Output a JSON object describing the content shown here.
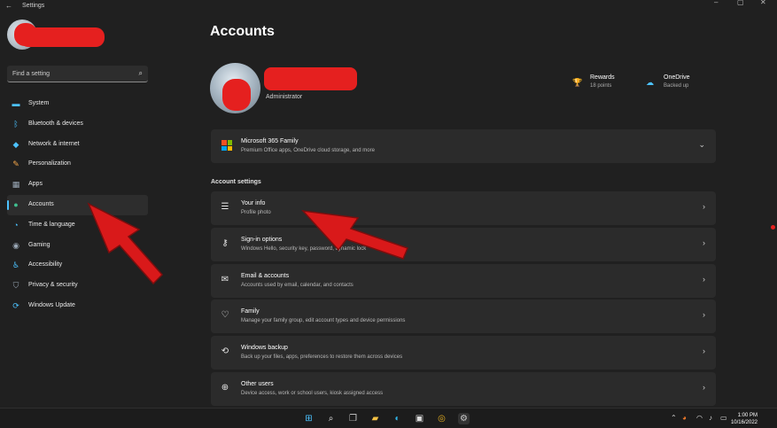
{
  "window": {
    "title": "Settings",
    "back_glyph": "←",
    "controls": [
      "–",
      "▢",
      "✕"
    ]
  },
  "sidebar": {
    "search_placeholder": "Find a setting",
    "search_icon": "search-icon",
    "items": [
      {
        "label": "System",
        "icon": "monitor-icon",
        "color": "#4cc2ff"
      },
      {
        "label": "Bluetooth & devices",
        "icon": "bluetooth-icon",
        "color": "#4cc2ff"
      },
      {
        "label": "Network & internet",
        "icon": "wifi-icon",
        "color": "#4cc2ff"
      },
      {
        "label": "Personalization",
        "icon": "brush-icon",
        "color": "#f7a84a"
      },
      {
        "label": "Apps",
        "icon": "apps-icon",
        "color": "#9aa7b5"
      },
      {
        "label": "Accounts",
        "icon": "person-icon",
        "color": "#3fbf8f",
        "active": true
      },
      {
        "label": "Time & language",
        "icon": "globe-clock-icon",
        "color": "#4cc2ff"
      },
      {
        "label": "Gaming",
        "icon": "gamepad-icon",
        "color": "#9aa7b5"
      },
      {
        "label": "Accessibility",
        "icon": "accessibility-icon",
        "color": "#4cc2ff"
      },
      {
        "label": "Privacy & security",
        "icon": "shield-icon",
        "color": "#9aa7b5"
      },
      {
        "label": "Windows Update",
        "icon": "update-icon",
        "color": "#4cc2ff"
      }
    ]
  },
  "main": {
    "title": "Accounts",
    "profile": {
      "role": "Administrator"
    },
    "rewards": [
      {
        "title": "Rewards",
        "subtitle": "18 points",
        "icon": "trophy-icon"
      },
      {
        "title": "OneDrive",
        "subtitle": "Backed up",
        "icon": "cloud-icon"
      }
    ],
    "m365": {
      "title": "Microsoft 365 Family",
      "subtitle": "Premium Office apps, OneDrive cloud storage, and more"
    },
    "section_label": "Account settings",
    "settings": [
      {
        "title": "Your info",
        "subtitle": "Profile photo",
        "icon": "person-card-icon"
      },
      {
        "title": "Sign-in options",
        "subtitle": "Windows Hello, security key, password, dynamic lock",
        "icon": "key-icon"
      },
      {
        "title": "Email & accounts",
        "subtitle": "Accounts used by email, calendar, and contacts",
        "icon": "mail-icon"
      },
      {
        "title": "Family",
        "subtitle": "Manage your family group, edit account types and device permissions",
        "icon": "heart-icon"
      },
      {
        "title": "Windows backup",
        "subtitle": "Back up your files, apps, preferences to restore them across devices",
        "icon": "backup-icon"
      },
      {
        "title": "Other users",
        "subtitle": "Device access, work or school users, kiosk assigned access",
        "icon": "add-user-icon"
      }
    ]
  },
  "taskbar": {
    "time": "1:00 PM",
    "date": "10/16/2022",
    "icons": [
      "windows-start-icon",
      "search-icon",
      "task-view-icon",
      "file-explorer-icon",
      "edge-icon",
      "store-icon",
      "chrome-icon",
      "settings-icon"
    ]
  },
  "colors": {
    "accent": "#4cc2ff",
    "annotation_red": "#e5201f"
  }
}
